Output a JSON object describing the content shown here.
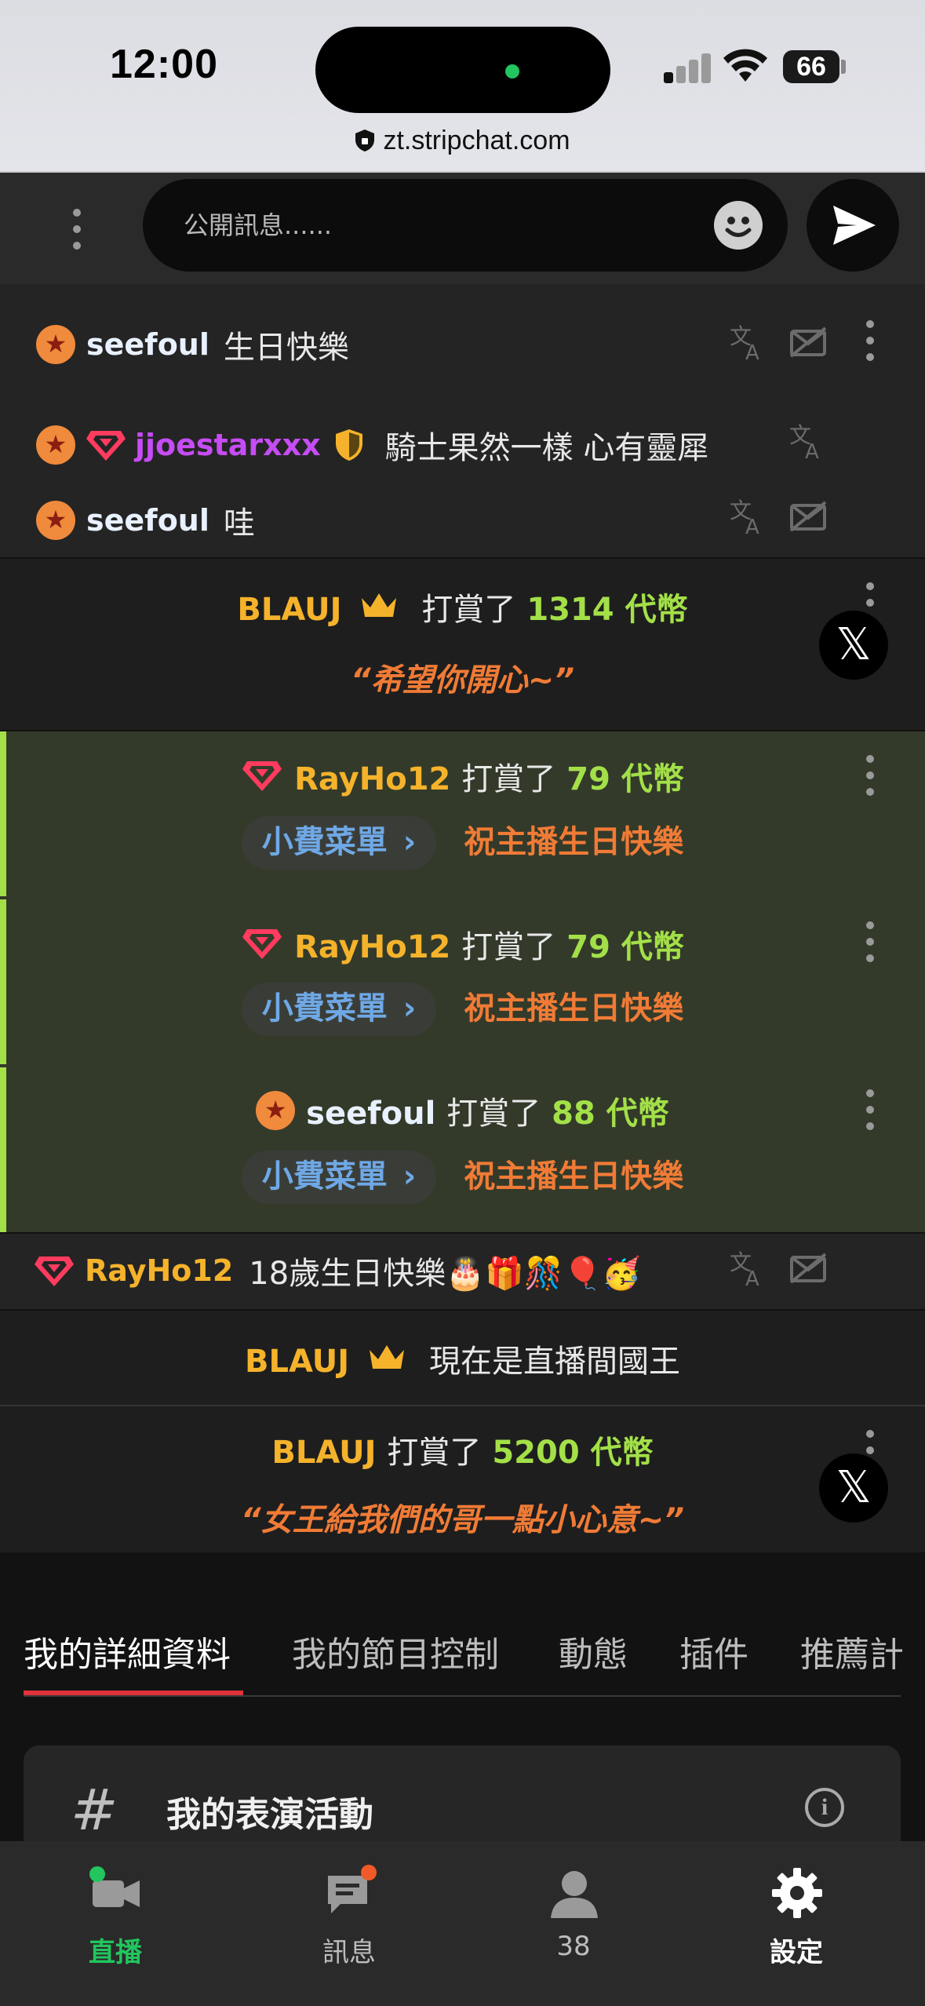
{
  "status_bar": {
    "time": "12:00",
    "battery": "66",
    "url": "zt.stripchat.com"
  },
  "chat_input": {
    "placeholder": "公開訊息......"
  },
  "messages": [
    {
      "user": "seefoul",
      "text": "生日快樂"
    },
    {
      "user": "jjoestarxxx",
      "text": "騎士果然一樣 心有靈犀"
    },
    {
      "user": "seefoul",
      "text": "哇"
    }
  ],
  "tip_blauj_1": {
    "user": "BLAUJ",
    "verb": "打賞了",
    "amount": "1314 代幣",
    "note": "“希望你開心~”"
  },
  "tip_rayho_1": {
    "user": "RayHo12",
    "verb": "打賞了",
    "amount": "79 代幣",
    "menu": "小費菜單",
    "item": "祝主播生日快樂"
  },
  "tip_rayho_2": {
    "user": "RayHo12",
    "verb": "打賞了",
    "amount": "79 代幣",
    "menu": "小費菜單",
    "item": "祝主播生日快樂"
  },
  "tip_seefoul": {
    "user": "seefoul",
    "verb": "打賞了",
    "amount": "88 代幣",
    "menu": "小費菜單",
    "item": "祝主播生日快樂"
  },
  "rayho_msg": {
    "user": "RayHo12",
    "text": "18歲生日快樂🎂🎁🎊🎈🥳"
  },
  "king_notice": {
    "user": "BLAUJ",
    "text": "現在是直播間國王"
  },
  "tip_blauj_2": {
    "user": "BLAUJ",
    "verb": "打賞了",
    "amount": "5200 代幣",
    "note": "“女王給我們的哥一點小心意~”"
  },
  "tabs": [
    "我的詳細資料",
    "我的節目控制",
    "動態",
    "插件",
    "推薦計"
  ],
  "card": {
    "hash": "#",
    "title": "我的表演活動"
  },
  "bottom_nav": [
    {
      "label": "直播",
      "icon": "video-camera-icon"
    },
    {
      "label": "訊息",
      "icon": "messages-icon"
    },
    {
      "label": "38",
      "icon": "user-icon"
    },
    {
      "label": "設定",
      "icon": "gear-icon"
    }
  ],
  "colors": {
    "gold": "#f5b32b",
    "green": "#a3e048",
    "orange": "#f07b36",
    "pink_name": "#c64cf5",
    "tip_bg": "#333a2a",
    "accent_bar": "#a3e048",
    "tab_underline": "#e0323a",
    "live_green": "#22c55e"
  }
}
